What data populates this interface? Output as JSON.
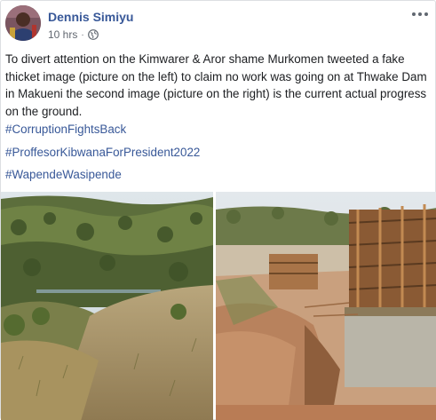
{
  "post": {
    "author": "Dennis Simiyu",
    "timestamp": "10 hrs",
    "separator": "·",
    "privacy_icon": "globe-icon",
    "more_icon": "more-options-icon",
    "body": "To divert attention on the Kimwarer & Aror shame Murkomen tweeted a fake thicket image (picture on the left) to claim no work was going on at Thwake Dam in Makueni the second image (picture on the right) is the current actual progress on the ground.",
    "hashtags": [
      "#CorruptionFightsBack",
      "#ProffesorKibwanaForPresident2022",
      "#WapendeWasipende"
    ],
    "photos": [
      {
        "name": "thicket-photo"
      },
      {
        "name": "dam-construction-photo"
      }
    ]
  },
  "colors": {
    "link": "#385898",
    "text": "#1c1e21",
    "meta": "#616770"
  }
}
